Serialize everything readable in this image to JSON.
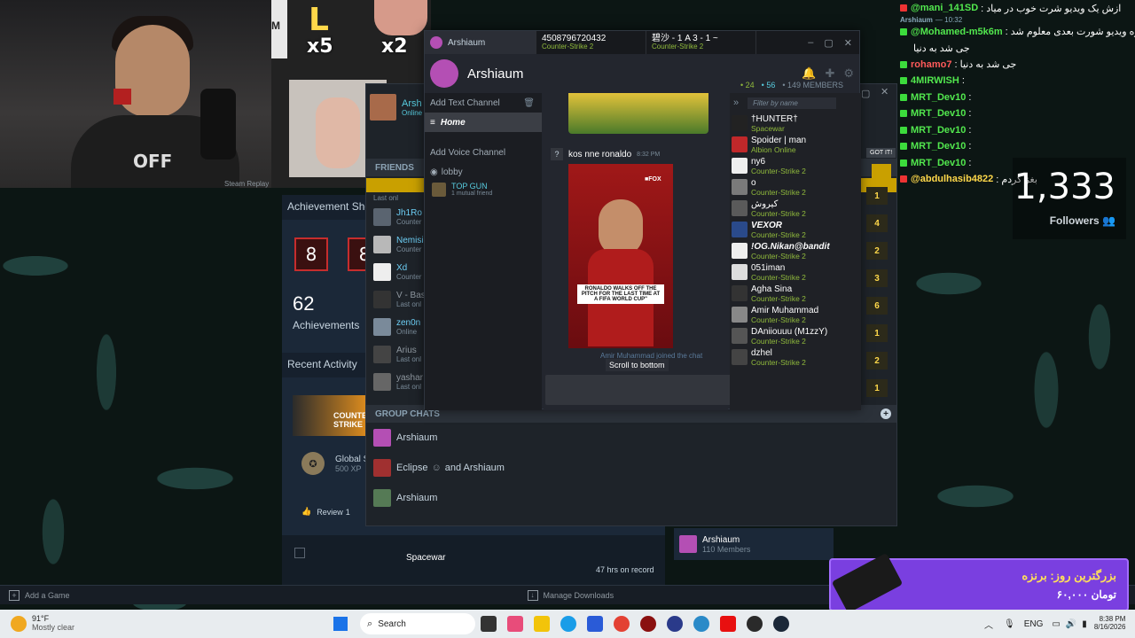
{
  "stream": {
    "overlay_letter": "L",
    "overlay_x5": "x5",
    "overlay_x2": "x2",
    "overlay_m": "M",
    "off_text": "OFF",
    "followers_count": "1,333",
    "followers_label": "Followers",
    "promo_title": "بزرگترین روز: برنزه",
    "promo_amount": "۶۰,۰۰۰ تومان",
    "chat": [
      {
        "name": "@mani_141SD",
        "msg": ": ازش یک ویدیو شرت خوب در میاد"
      },
      {
        "name": "Arshiaum",
        "msg": "— 10:32"
      },
      {
        "name": "@Mohamed-m5k6m",
        "msg": ": اره ویدیو شورت بعدی معلوم شد"
      },
      {
        "name": "",
        "msg": "جی شد به دنیا"
      },
      {
        "name": "rohamo7",
        "msg": ": جی شد به دنیا"
      },
      {
        "name": "4MIRWISH",
        "msg": ":"
      },
      {
        "name": "MRT_Dev10",
        "msg": ":"
      },
      {
        "name": "MRT_Dev10",
        "msg": ":"
      },
      {
        "name": "MRT_Dev10",
        "msg": ":"
      },
      {
        "name": "MRT_Dev10",
        "msg": ":"
      },
      {
        "name": "MRT_Dev10",
        "msg": ":"
      },
      {
        "name": "@abdulhasib4822",
        "msg": ": بغز کردم"
      }
    ]
  },
  "steam": {
    "profile_name": "Arsh",
    "profile_status": "Online",
    "steam_replay": "Steam Replay",
    "achievement_showcase": "Achievement Sho",
    "achievement_cards": [
      "8",
      "8"
    ],
    "achievements_count": "62",
    "achievements_label": "Achievements",
    "recent_activity": "Recent Activity",
    "game_banner": "COUNTER STRIKE",
    "global_label": "Global S",
    "xp_label": "500 XP",
    "review_label": "Review",
    "review_count": "1",
    "spacewar": "Spacewar",
    "hours_on_record": "47 hrs on record",
    "add_game": "Add a Game",
    "manage_downloads": "Manage Downloads",
    "group_name": "Arshiaum",
    "group_members": "110 Members"
  },
  "friends": {
    "header": "FRIENDS",
    "items": [
      {
        "name": "",
        "sub": "Last onl"
      },
      {
        "name": "Jh1Ro",
        "sub": "Counter"
      },
      {
        "name": "Nemisi",
        "sub": "Counter"
      },
      {
        "name": "Xd",
        "sub": "Counter"
      },
      {
        "name": "V - Bas",
        "sub": "Last onl"
      },
      {
        "name": "zen0n",
        "sub": "Online"
      },
      {
        "name": "Arius",
        "sub": "Last onl"
      },
      {
        "name": "yashar",
        "sub": "Last onl"
      }
    ],
    "got_it": "GOT IT!",
    "group_chats_header": "GROUP CHATS",
    "group_chats": [
      {
        "name": "Arshiaum"
      },
      {
        "name": "Eclipse",
        "extra": "and Arshiaum"
      },
      {
        "name": "Arshiaum"
      }
    ],
    "right_numbers": [
      "1",
      "4",
      "2",
      "3",
      "6",
      "1",
      "2",
      "1"
    ]
  },
  "chat_window": {
    "tabs": [
      {
        "label": "Arshiaum",
        "sub": ""
      },
      {
        "label": "4508796720432",
        "sub": "Counter-Strike 2"
      },
      {
        "label": "碧沙 - 1 A 3 - 1 ~",
        "sub": "Counter-Strike 2"
      }
    ],
    "group_title": "Arshiaum",
    "online_count": "24",
    "ingame_count": "56",
    "members_count": "149 MEMBERS",
    "add_text_channel": "Add Text Channel",
    "home_channel": "Home",
    "add_voice_channel": "Add Voice Channel",
    "lobby": "lobby",
    "voice_user": "TOP GUN",
    "voice_user_sub": "1 mutual friend",
    "message_prefix": "?",
    "message_text": "kos nne ronaldo",
    "message_time": "8:32 PM",
    "image_caption": "RONALDO WALKS OFF THE PITCH FOR THE LAST TIME AT A FIFA WORLD CUP\"",
    "joined_text": "Amir Muhammad joined the chat",
    "scroll_to_bottom": "Scroll to bottom",
    "filter_placeholder": "Filter by name",
    "members": [
      {
        "name": "†HUNTER†",
        "status": "Spacewar"
      },
      {
        "name": "Spoider | man",
        "status": "Albion Online"
      },
      {
        "name": "ny6",
        "status": "Counter-Strike 2"
      },
      {
        "name": "o",
        "status": "Counter-Strike 2"
      },
      {
        "name": "کیروش",
        "status": "Counter-Strike 2"
      },
      {
        "name": "VEXOR",
        "status": "Counter-Strike 2"
      },
      {
        "name": "!OG.Nikan@bandit",
        "status": "Counter-Strike 2"
      },
      {
        "name": "051iman",
        "status": "Counter-Strike 2"
      },
      {
        "name": "Agha Sina",
        "status": "Counter-Strike 2"
      },
      {
        "name": "Amir Muhammad",
        "status": "Counter-Strike 2"
      },
      {
        "name": "DAniiouuu (M1zzY)",
        "status": "Counter-Strike 2"
      },
      {
        "name": "dzhel",
        "status": "Counter-Strike 2"
      }
    ]
  },
  "taskbar": {
    "temp": "91°F",
    "weather": "Mostly clear",
    "search": "Search",
    "lang": "ENG",
    "time": "8:38 PM",
    "date": "8/16/2026"
  }
}
